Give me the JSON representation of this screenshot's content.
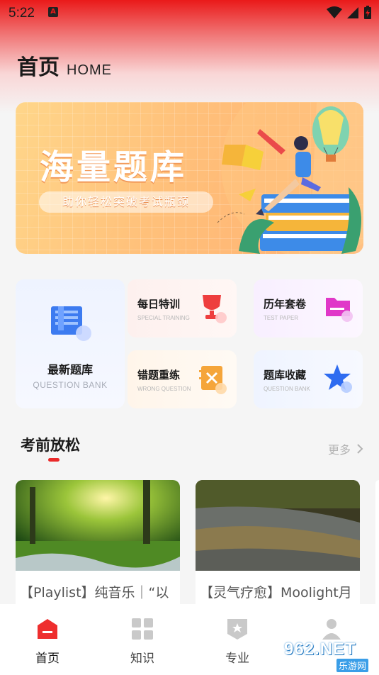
{
  "status": {
    "time": "5:22",
    "notif": "A"
  },
  "header": {
    "title_zh": "首页",
    "title_en": "HOME"
  },
  "banner": {
    "title": "海量题库",
    "subtitle": "助你轻松突破考试瓶颈"
  },
  "features": {
    "big": {
      "title": "最新题库",
      "subtitle": "QUESTION BANK"
    },
    "items": [
      {
        "title": "每日特训",
        "subtitle": "SPECIAL TRAINING",
        "icon": "trophy-icon"
      },
      {
        "title": "历年套卷",
        "subtitle": "TEST PAPER",
        "icon": "folder-icon"
      },
      {
        "title": "错题重练",
        "subtitle": "WRONG QUESTION",
        "icon": "notebook-x-icon"
      },
      {
        "title": "题库收藏",
        "subtitle": "QUESTION BANK",
        "icon": "star-icon"
      }
    ]
  },
  "relax": {
    "title": "考前放松",
    "more": "更多",
    "videos": [
      {
        "caption": "【Playlist】纯音乐｜“以"
      },
      {
        "caption": "【灵气疗愈】Moolight月"
      }
    ]
  },
  "tabs": [
    {
      "label": "首页",
      "icon": "home-icon",
      "active": true
    },
    {
      "label": "知识",
      "icon": "grid-icon",
      "active": false
    },
    {
      "label": "专业",
      "icon": "badge-star-icon",
      "active": false
    },
    {
      "label": "",
      "icon": "user-icon",
      "active": false
    }
  ],
  "watermark": {
    "brand": "962.NET",
    "sub": "乐游网"
  },
  "colors": {
    "accent": "#ea1a1a",
    "banner": "#ffc07a"
  }
}
